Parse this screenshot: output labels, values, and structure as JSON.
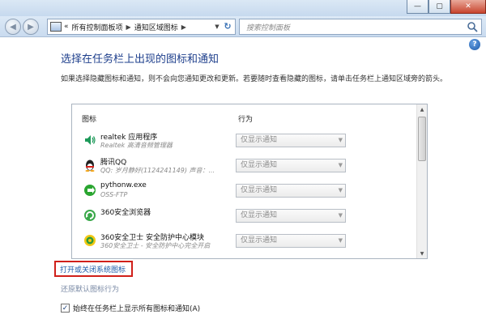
{
  "window": {
    "minimize": "—",
    "maximize": "▢",
    "close": "✕"
  },
  "nav": {
    "breadcrumb_prefix": "«",
    "crumbs": [
      "所有控制面板项",
      "通知区域图标"
    ],
    "search_placeholder": "搜索控制面板"
  },
  "main": {
    "heading": "选择在任务栏上出现的图标和通知",
    "description": "如果选择隐藏图标和通知，则不会向您通知更改和更新。若要随时查看隐藏的图标，请单击任务栏上通知区域旁的箭头。",
    "list": {
      "col_icon": "图标",
      "col_behavior": "行为",
      "rows": [
        {
          "name": "realtek 应用程序",
          "sub": "Realtek 高清音频管理器",
          "behavior": "仅显示通知",
          "icon": "speaker-icon"
        },
        {
          "name": "腾讯QQ",
          "sub": "QQ: 岁月静好(1124241149)  声音：...",
          "behavior": "仅显示通知",
          "icon": "qq-penguin-icon"
        },
        {
          "name": "pythonw.exe",
          "sub": "OSS-FTP",
          "behavior": "仅显示通知",
          "icon": "green-arrow-icon"
        },
        {
          "name": "360安全浏览器",
          "sub": "",
          "behavior": "仅显示通知",
          "icon": "360-browser-icon"
        },
        {
          "name": "360安全卫士 安全防护中心模块",
          "sub": "360安全卫士 - 安全防护中心完全开启",
          "behavior": "仅显示通知",
          "icon": "360-guard-icon"
        }
      ]
    },
    "link_system_icons": "打开或关闭系统图标",
    "link_restore": "还原默认图标行为",
    "checkbox_label": "始终在任务栏上显示所有图标和通知(A)",
    "checkbox_checked": true
  },
  "colors": {
    "heading": "#1e3f8c",
    "link": "#1d5aa8",
    "highlight_box": "#d0201a"
  }
}
